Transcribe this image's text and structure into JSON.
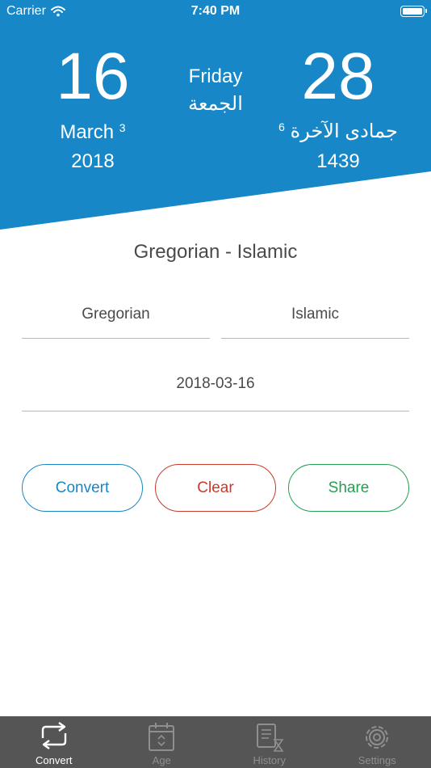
{
  "status_bar": {
    "carrier": "Carrier",
    "time": "7:40 PM"
  },
  "header": {
    "gregorian": {
      "day": "16",
      "month": "March",
      "month_number": "3",
      "year": "2018"
    },
    "weekday": {
      "english": "Friday",
      "arabic": "الجمعة"
    },
    "islamic": {
      "day": "28",
      "month": "جمادى الآخرة",
      "month_number": "6",
      "year": "1439"
    }
  },
  "converter": {
    "title": "Gregorian - Islamic",
    "from_calendar": "Gregorian",
    "to_calendar": "Islamic",
    "date_value": "2018-03-16"
  },
  "buttons": {
    "convert": "Convert",
    "clear": "Clear",
    "share": "Share"
  },
  "tabs": [
    {
      "label": "Convert",
      "icon": "convert-arrows-icon",
      "active": true
    },
    {
      "label": "Age",
      "icon": "calendar-icon",
      "active": false
    },
    {
      "label": "History",
      "icon": "scroll-hourglass-icon",
      "active": false
    },
    {
      "label": "Settings",
      "icon": "gear-icon",
      "active": false
    }
  ],
  "colors": {
    "header_blue": "#1787c7",
    "convert": "#1787c7",
    "clear": "#c93a2b",
    "share": "#25a052",
    "tabbar": "#555555"
  }
}
